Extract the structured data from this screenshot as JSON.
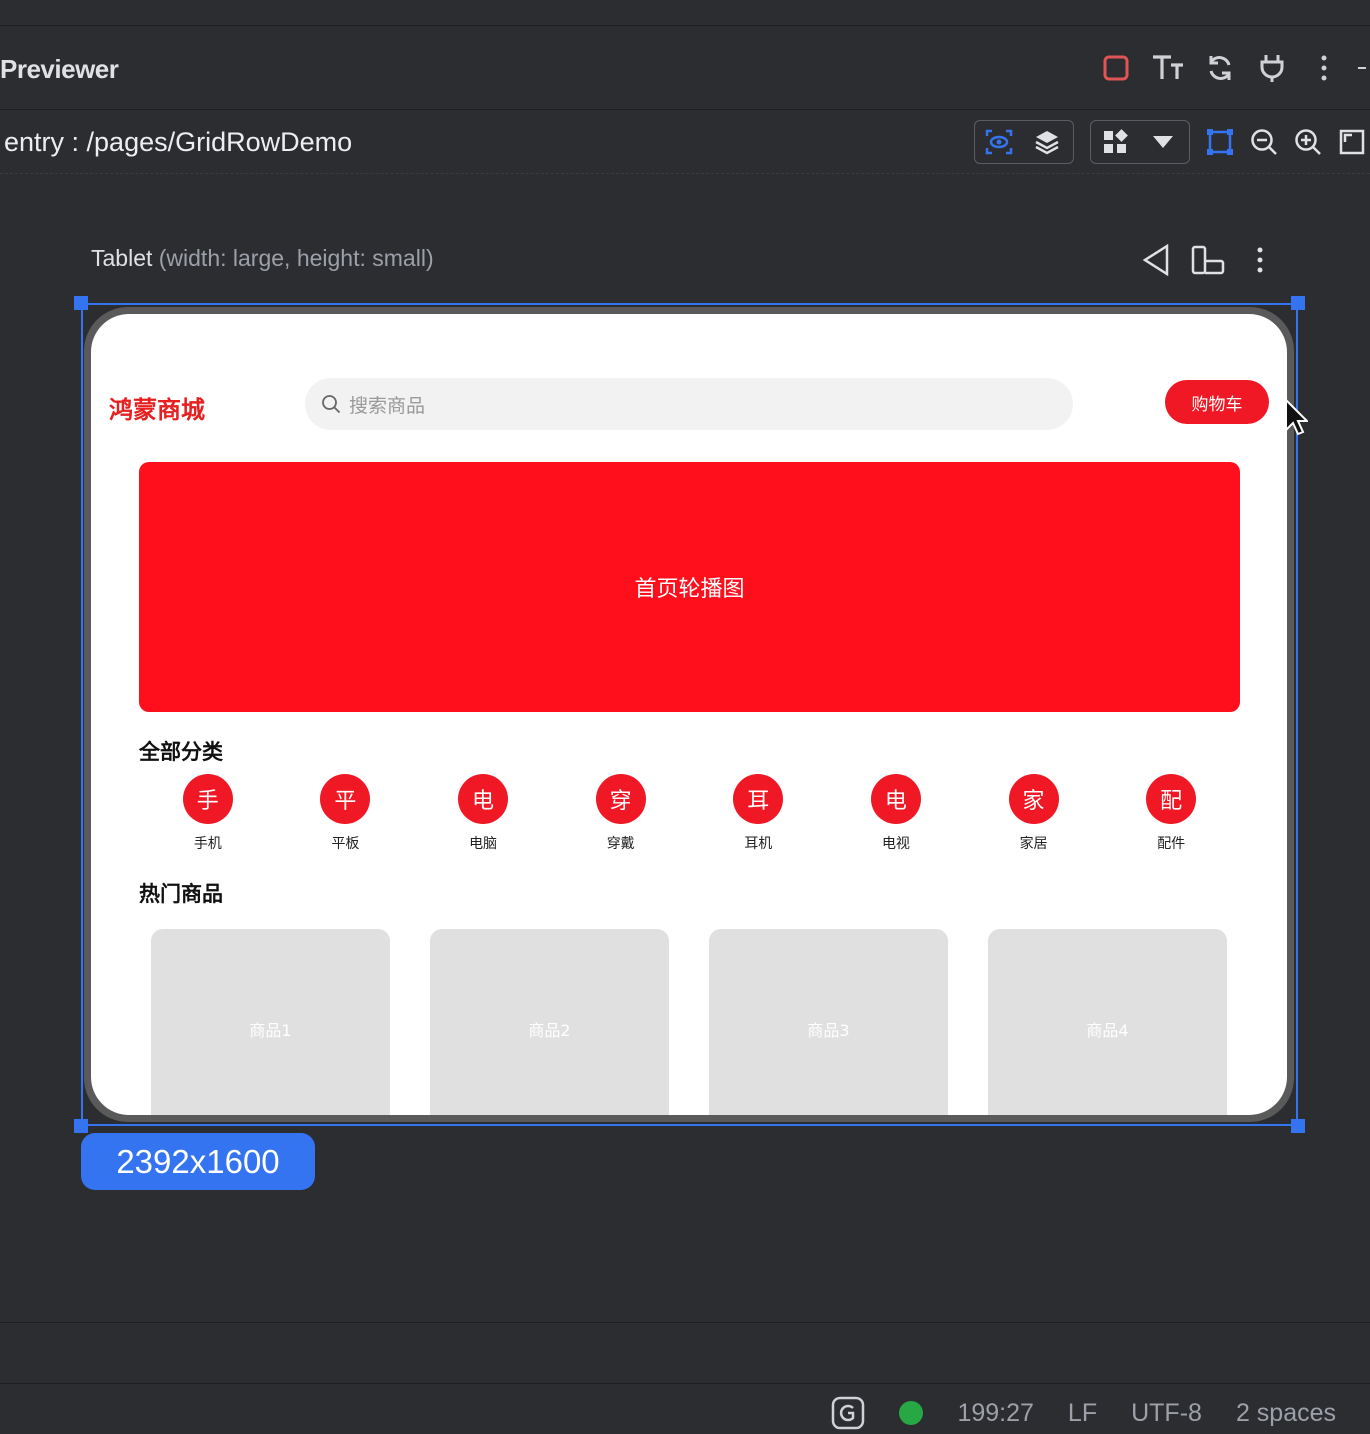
{
  "window": {
    "title": "Previewer",
    "toolbar_icons": [
      "stop-icon",
      "font-size-icon",
      "refresh-icon",
      "plug-icon",
      "more-vertical-icon"
    ]
  },
  "pathbar": {
    "path": "entry : /pages/GridRowDemo"
  },
  "device": {
    "name": "Tablet",
    "spec": "(width: large, height: small)",
    "resolution": "2392x1600"
  },
  "app": {
    "brand": "鸿蒙商城",
    "search_placeholder": "搜索商品",
    "cart_label": "购物车",
    "banner_text": "首页轮播图",
    "categories_title": "全部分类",
    "categories": [
      {
        "icon": "手",
        "label": "手机"
      },
      {
        "icon": "平",
        "label": "平板"
      },
      {
        "icon": "电",
        "label": "电脑"
      },
      {
        "icon": "穿",
        "label": "穿戴"
      },
      {
        "icon": "耳",
        "label": "耳机"
      },
      {
        "icon": "电",
        "label": "电视"
      },
      {
        "icon": "家",
        "label": "家居"
      },
      {
        "icon": "配",
        "label": "配件"
      }
    ],
    "hot_title": "热门商品",
    "products": [
      "商品1",
      "商品2",
      "商品3",
      "商品4"
    ]
  },
  "statusbar": {
    "position": "199:27",
    "line_ending": "LF",
    "encoding": "UTF-8",
    "indent": "2 spaces"
  },
  "colors": {
    "accent": "#f01824",
    "banner": "#ff0e1c",
    "selection": "#3574f0",
    "status_ok": "#28a745"
  }
}
